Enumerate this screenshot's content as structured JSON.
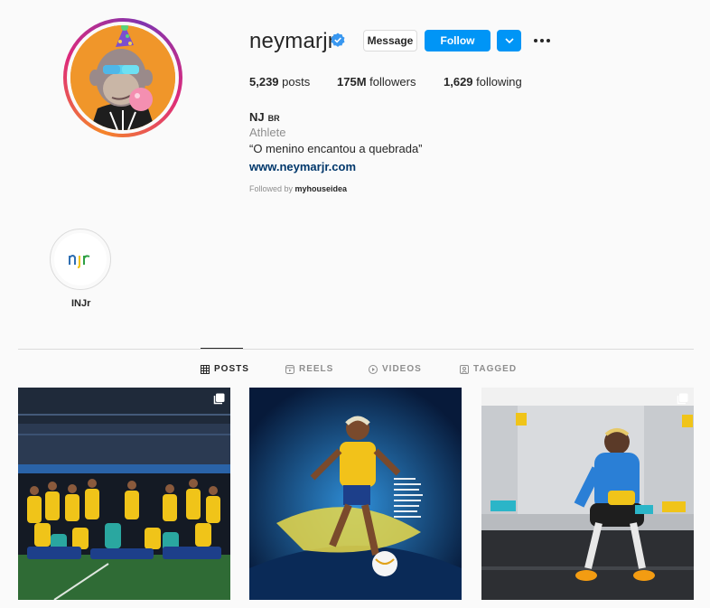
{
  "profile": {
    "username": "neymarjr",
    "verified": true,
    "actions": {
      "message_label": "Message",
      "follow_label": "Follow"
    },
    "stats": {
      "posts_count": "5,239",
      "posts_label": "posts",
      "followers_count": "175M",
      "followers_label": "followers",
      "following_count": "1,629",
      "following_label": "following"
    },
    "bio": {
      "name": "NJ",
      "country_code": "BR",
      "category": "Athlete",
      "text": "“O menino encantou a quebrada”",
      "link": "www.neymarjr.com",
      "followed_by_prefix": "Followed by",
      "followed_by_user": "myhouseidea"
    }
  },
  "highlights": [
    {
      "label": "INJr",
      "icon_text": "njr"
    }
  ],
  "tabs": [
    {
      "label": "POSTS",
      "icon": "grid-icon",
      "active": true
    },
    {
      "label": "REELS",
      "icon": "reels-icon",
      "active": false
    },
    {
      "label": "VIDEOS",
      "icon": "play-icon",
      "active": false
    },
    {
      "label": "TAGGED",
      "icon": "tag-icon",
      "active": false
    }
  ],
  "posts": [
    {
      "description_icon": "multi-image-icon"
    },
    {
      "description_icon": "none"
    },
    {
      "description_icon": "multi-image-icon"
    }
  ],
  "colors": {
    "accent": "#0095f6",
    "verified": "#3897f0",
    "link": "#00376b",
    "secondary_text": "#8e8e8e"
  }
}
